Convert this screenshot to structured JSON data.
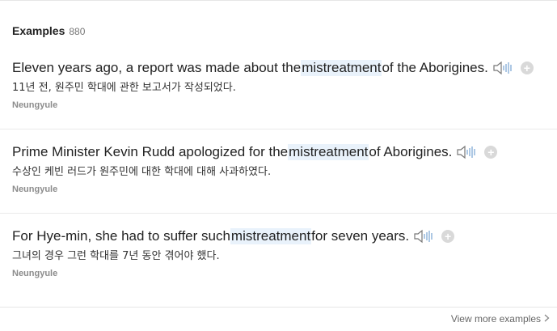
{
  "section": {
    "title": "Examples",
    "count": "880"
  },
  "examples": [
    {
      "en_before": "Eleven years ago, a report was made about the ",
      "en_highlight": "mistreatment",
      "en_after": " of the Aborigines.",
      "ko": "11년 전, 원주민 학대에 관한 보고서가 작성되었다.",
      "source": "Neungyule"
    },
    {
      "en_before": "Prime Minister Kevin Rudd apologized for the ",
      "en_highlight": "mistreatment",
      "en_after": " of Aborigines.",
      "ko": "수상인 케빈 러드가 원주민에 대한 학대에 대해 사과하였다.",
      "source": "Neungyule"
    },
    {
      "en_before": "For Hye-min, she had to suffer such ",
      "en_highlight": "mistreatment",
      "en_after": " for seven years.",
      "ko": "그녀의 경우 그런 학대를 7년 동안 겪어야 했다.",
      "source": "Neungyule"
    }
  ],
  "footer": {
    "view_more_label": "View more examples",
    "chevron_icon": "chevron-right-icon",
    "speaker_icon": "speaker-icon",
    "add_icon": "plus-circle-icon",
    "highlight_color": "#e9f2fb"
  }
}
